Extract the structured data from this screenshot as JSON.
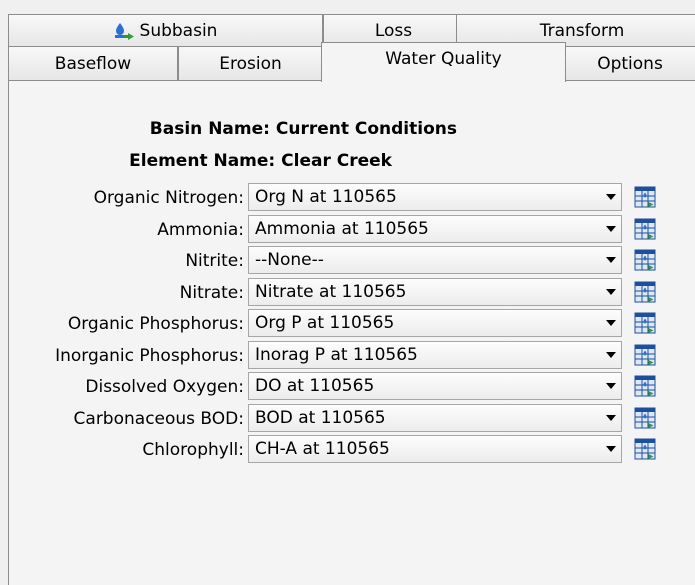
{
  "tabs": {
    "top": [
      {
        "label": "Subbasin",
        "icon": "subbasin-icon"
      },
      {
        "label": "Loss"
      },
      {
        "label": "Transform"
      }
    ],
    "bottom": [
      {
        "label": "Baseflow"
      },
      {
        "label": "Erosion"
      },
      {
        "label": "Water Quality",
        "selected": true
      },
      {
        "label": "Options"
      }
    ]
  },
  "header": {
    "basin_label": "Basin Name:",
    "basin_value": "Current Conditions",
    "element_label": "Element Name:",
    "element_value": "Clear Creek"
  },
  "rows": [
    {
      "label": "Organic Nitrogen:",
      "value": "Org N at 110565"
    },
    {
      "label": "Ammonia:",
      "value": "Ammonia at 110565"
    },
    {
      "label": "Nitrite:",
      "value": "--None--"
    },
    {
      "label": "Nitrate:",
      "value": "Nitrate at 110565"
    },
    {
      "label": "Organic Phosphorus:",
      "value": "Org P at 110565"
    },
    {
      "label": "Inorganic Phosphorus:",
      "value": "Inorag P at 110565"
    },
    {
      "label": "Dissolved Oxygen:",
      "value": "DO at 110565"
    },
    {
      "label": "Carbonaceous BOD:",
      "value": "BOD at 110565"
    },
    {
      "label": "Chlorophyll:",
      "value": "CH-A at 110565"
    }
  ],
  "colors": {
    "panel_bg": "#f4f4f4",
    "border": "#8c8c8c",
    "icon_blue": "#2a6fd1",
    "icon_green": "#2f9e3a"
  }
}
